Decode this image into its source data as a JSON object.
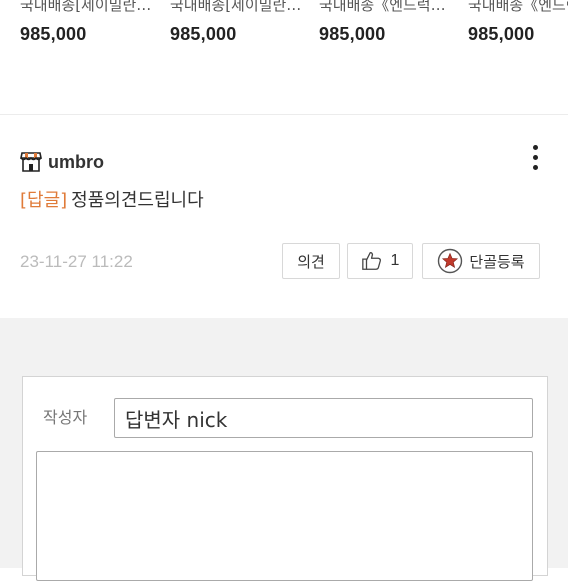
{
  "products": [
    {
      "title": "국내배송[제이밀란…",
      "price": "985,000"
    },
    {
      "title": "국내배송[제이밀란…",
      "price": "985,000"
    },
    {
      "title": "국내배송《엔드럭스…",
      "price": "985,000"
    },
    {
      "title": "국내배송《엔드럭",
      "price": "985,000"
    }
  ],
  "comment": {
    "author": "umbro",
    "reply_tag": "[답글]",
    "text": "정품의견드립니다",
    "date": "23-11-27 11:22",
    "opinion_label": "의견",
    "like_count": "1",
    "dangol_label": "단골등록"
  },
  "form": {
    "writer_label": "작성자",
    "writer_value": "답변자 nick"
  },
  "colors": {
    "reply_tag": "#e07b39",
    "dangol_icon": "#c0392b"
  },
  "icons": {
    "author": "shop-icon",
    "menu": "kebab-menu-icon",
    "like": "thumbs-up-icon",
    "dangol": "star-badge-icon"
  }
}
